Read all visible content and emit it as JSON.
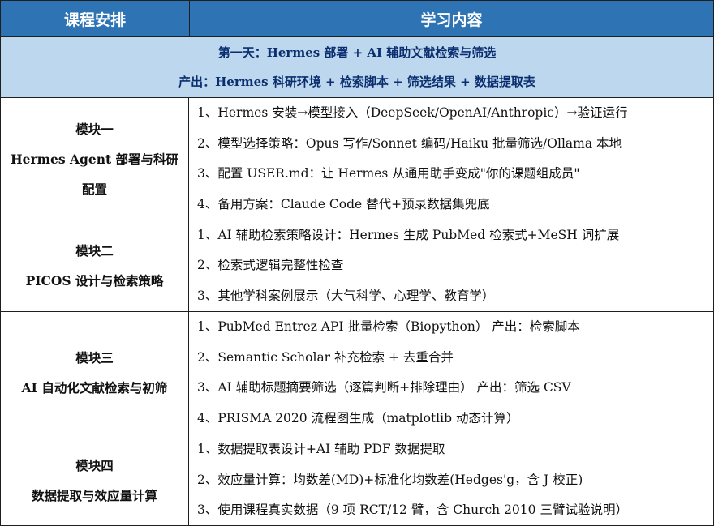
{
  "header": {
    "col1": "课程安排",
    "col2": "学习内容"
  },
  "day": {
    "line1": "第一天：Hermes 部署 + AI 辅助文献检索与筛选",
    "line2": "产出：Hermes 科研环境 + 检索脚本 + 筛选结果 + 数据提取表"
  },
  "modules": [
    {
      "title": "模块一",
      "subtitle": "Hermes Agent 部署与科研配置",
      "items": [
        "1、Hermes 安装→模型接入（DeepSeek/OpenAI/Anthropic）→验证运行",
        "2、模型选择策略：Opus 写作/Sonnet 编码/Haiku 批量筛选/Ollama 本地",
        "3、配置 USER.md：让 Hermes 从通用助手变成\"你的课题组成员\"",
        "4、备用方案：Claude Code 替代+预录数据集兜底"
      ]
    },
    {
      "title": "模块二",
      "subtitle": "PICOS 设计与检索策略",
      "items": [
        "1、AI 辅助检索策略设计：Hermes 生成 PubMed 检索式+MeSH 词扩展",
        "2、检索式逻辑完整性检查",
        "3、其他学科案例展示（大气科学、心理学、教育学）"
      ]
    },
    {
      "title": "模块三",
      "subtitle": "AI 自动化文献检索与初筛",
      "items": [
        "1、PubMed Entrez API 批量检索（Biopython） 产出：检索脚本",
        "2、Semantic Scholar 补充检索 + 去重合并",
        "3、AI 辅助标题摘要筛选（逐篇判断+排除理由） 产出：筛选 CSV",
        "4、PRISMA 2020 流程图生成（matplotlib 动态计算）"
      ]
    },
    {
      "title": "模块四",
      "subtitle": "数据提取与效应量计算",
      "items": [
        "1、数据提取表设计+AI 辅助 PDF 数据提取",
        "2、效应量计算：均数差(MD)+标准化均数差(Hedges'g，含 J 校正)",
        "3、使用课程真实数据（9 项 RCT/12 臂，含 Church 2010 三臂试验说明）"
      ]
    }
  ]
}
